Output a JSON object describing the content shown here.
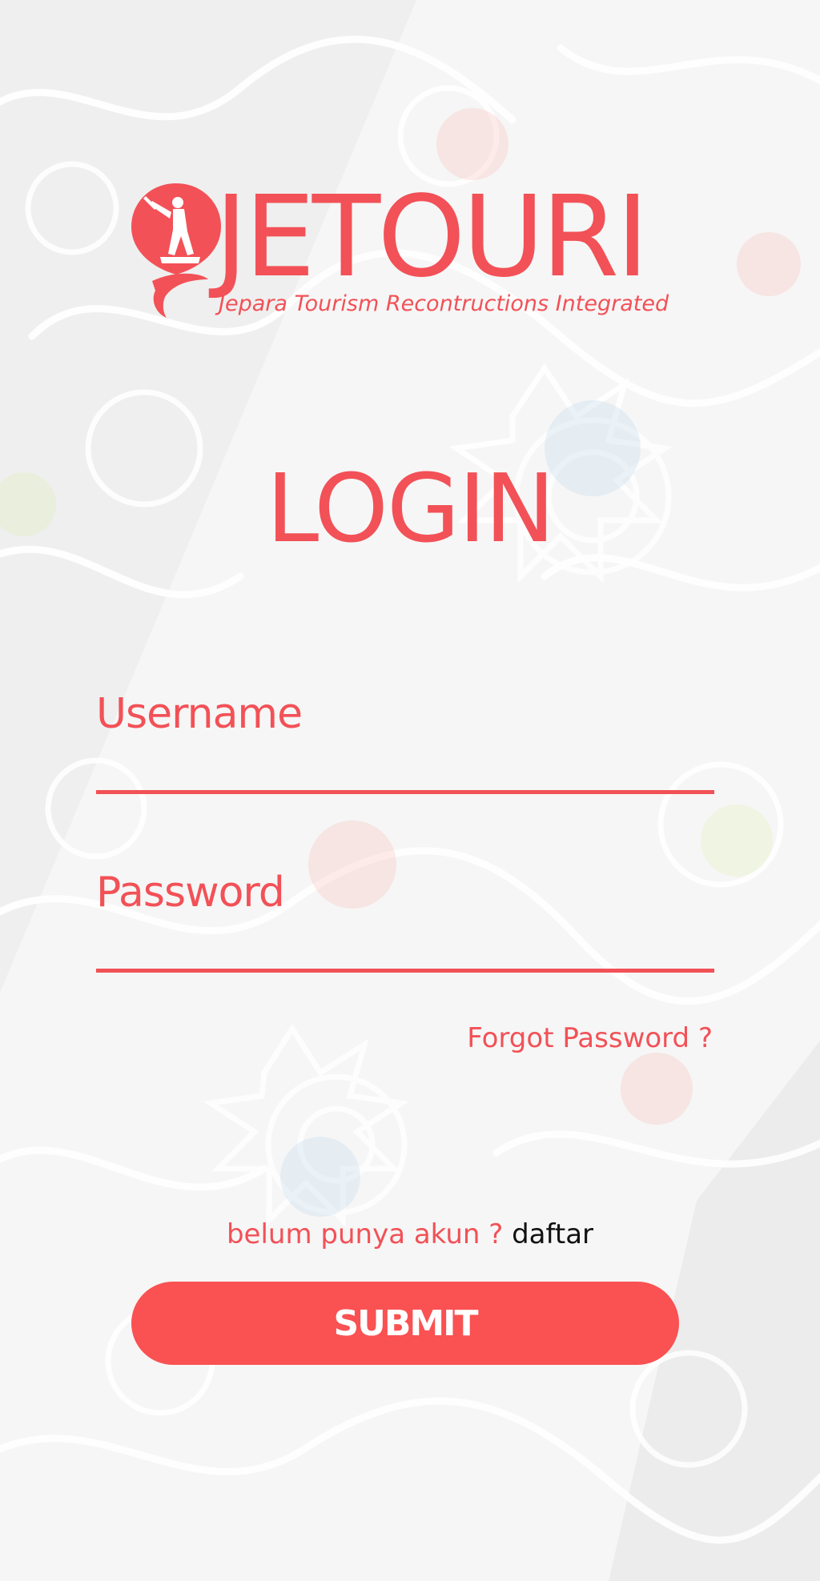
{
  "colors": {
    "accent": "#f25157",
    "button": "#fa5152",
    "background": "#f1f1f1"
  },
  "logo": {
    "wordmark": "JETOURI",
    "tagline": "Jepara Tourism Recontructions Integrated",
    "icon": "map-pin-statue-icon"
  },
  "login": {
    "title": "LOGIN"
  },
  "form": {
    "username_label": "Username",
    "username_value": "",
    "password_label": "Password",
    "password_value": "",
    "forgot_password": "Forgot Password ?"
  },
  "register": {
    "question": "belum punya akun ?",
    "link": "daftar"
  },
  "submit": {
    "label": "SUBMIT"
  }
}
